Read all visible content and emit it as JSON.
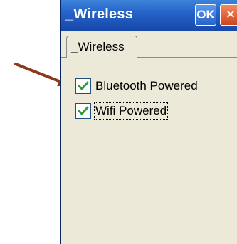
{
  "window": {
    "title": "_Wireless",
    "ok_label": "OK",
    "close_label": "✕"
  },
  "tabs": [
    {
      "label": "_Wireless",
      "selected": true
    }
  ],
  "checkboxes": [
    {
      "label": "Bluetooth Powered",
      "checked": true
    },
    {
      "label": "Wifi Powered",
      "checked": true
    }
  ],
  "colors": {
    "titlebar": "#2563c8",
    "window_bg": "#ece9d8",
    "checkmark": "#2e9a3a",
    "annotation_arrow": "#8b3a1a",
    "close_button": "#d0451c"
  }
}
